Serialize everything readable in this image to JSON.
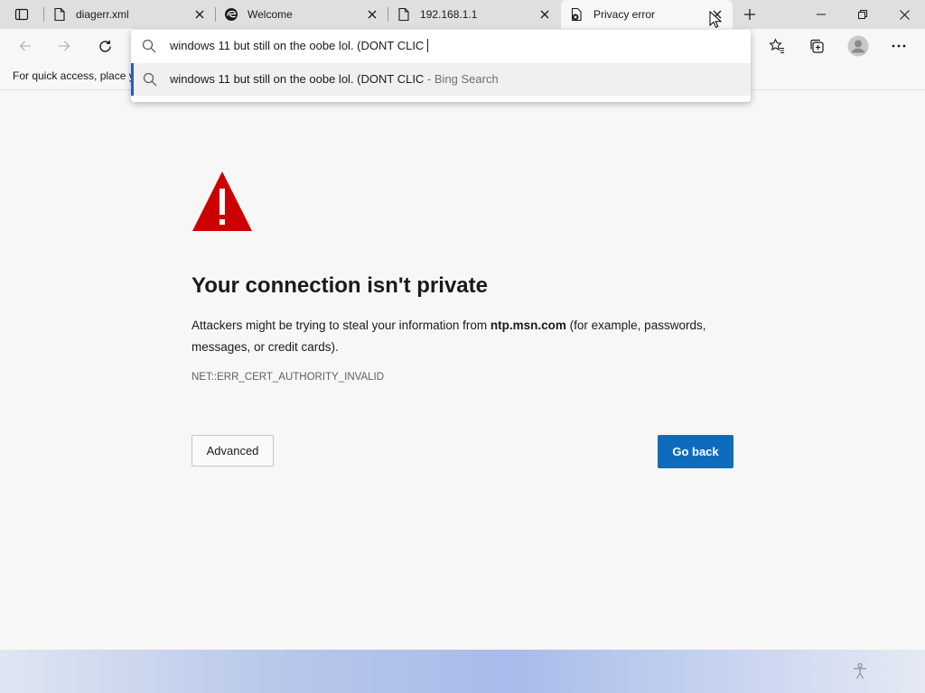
{
  "tabs": [
    {
      "title": "diagerr.xml",
      "favicon": "document-icon"
    },
    {
      "title": "Welcome",
      "favicon": "edge-icon"
    },
    {
      "title": "192.168.1.1",
      "favicon": "document-icon"
    },
    {
      "title": "Privacy error",
      "favicon": "insecure-document-icon",
      "active": true
    }
  ],
  "favorites_bar": {
    "text": "For quick access, place y"
  },
  "omnibox": {
    "input_value": "windows 11 but still on the oobe lol. (DONT CLIC",
    "suggestion_text": "windows 11 but still on the oobe lol. (DONT CLIC",
    "suggestion_source": " - Bing Search"
  },
  "page": {
    "heading": "Your connection isn't private",
    "description_before": "Attackers might be trying to steal your information from ",
    "host": "ntp.msn.com",
    "description_after": " (for example, passwords, messages, or credit cards).",
    "error_code": "NET::ERR_CERT_AUTHORITY_INVALID",
    "advanced_label": "Advanced",
    "go_back_label": "Go back"
  },
  "colors": {
    "warning_red": "#cc0000",
    "accent_blue": "#0f6cbd",
    "suggestion_indicator": "#2a5bbd"
  }
}
